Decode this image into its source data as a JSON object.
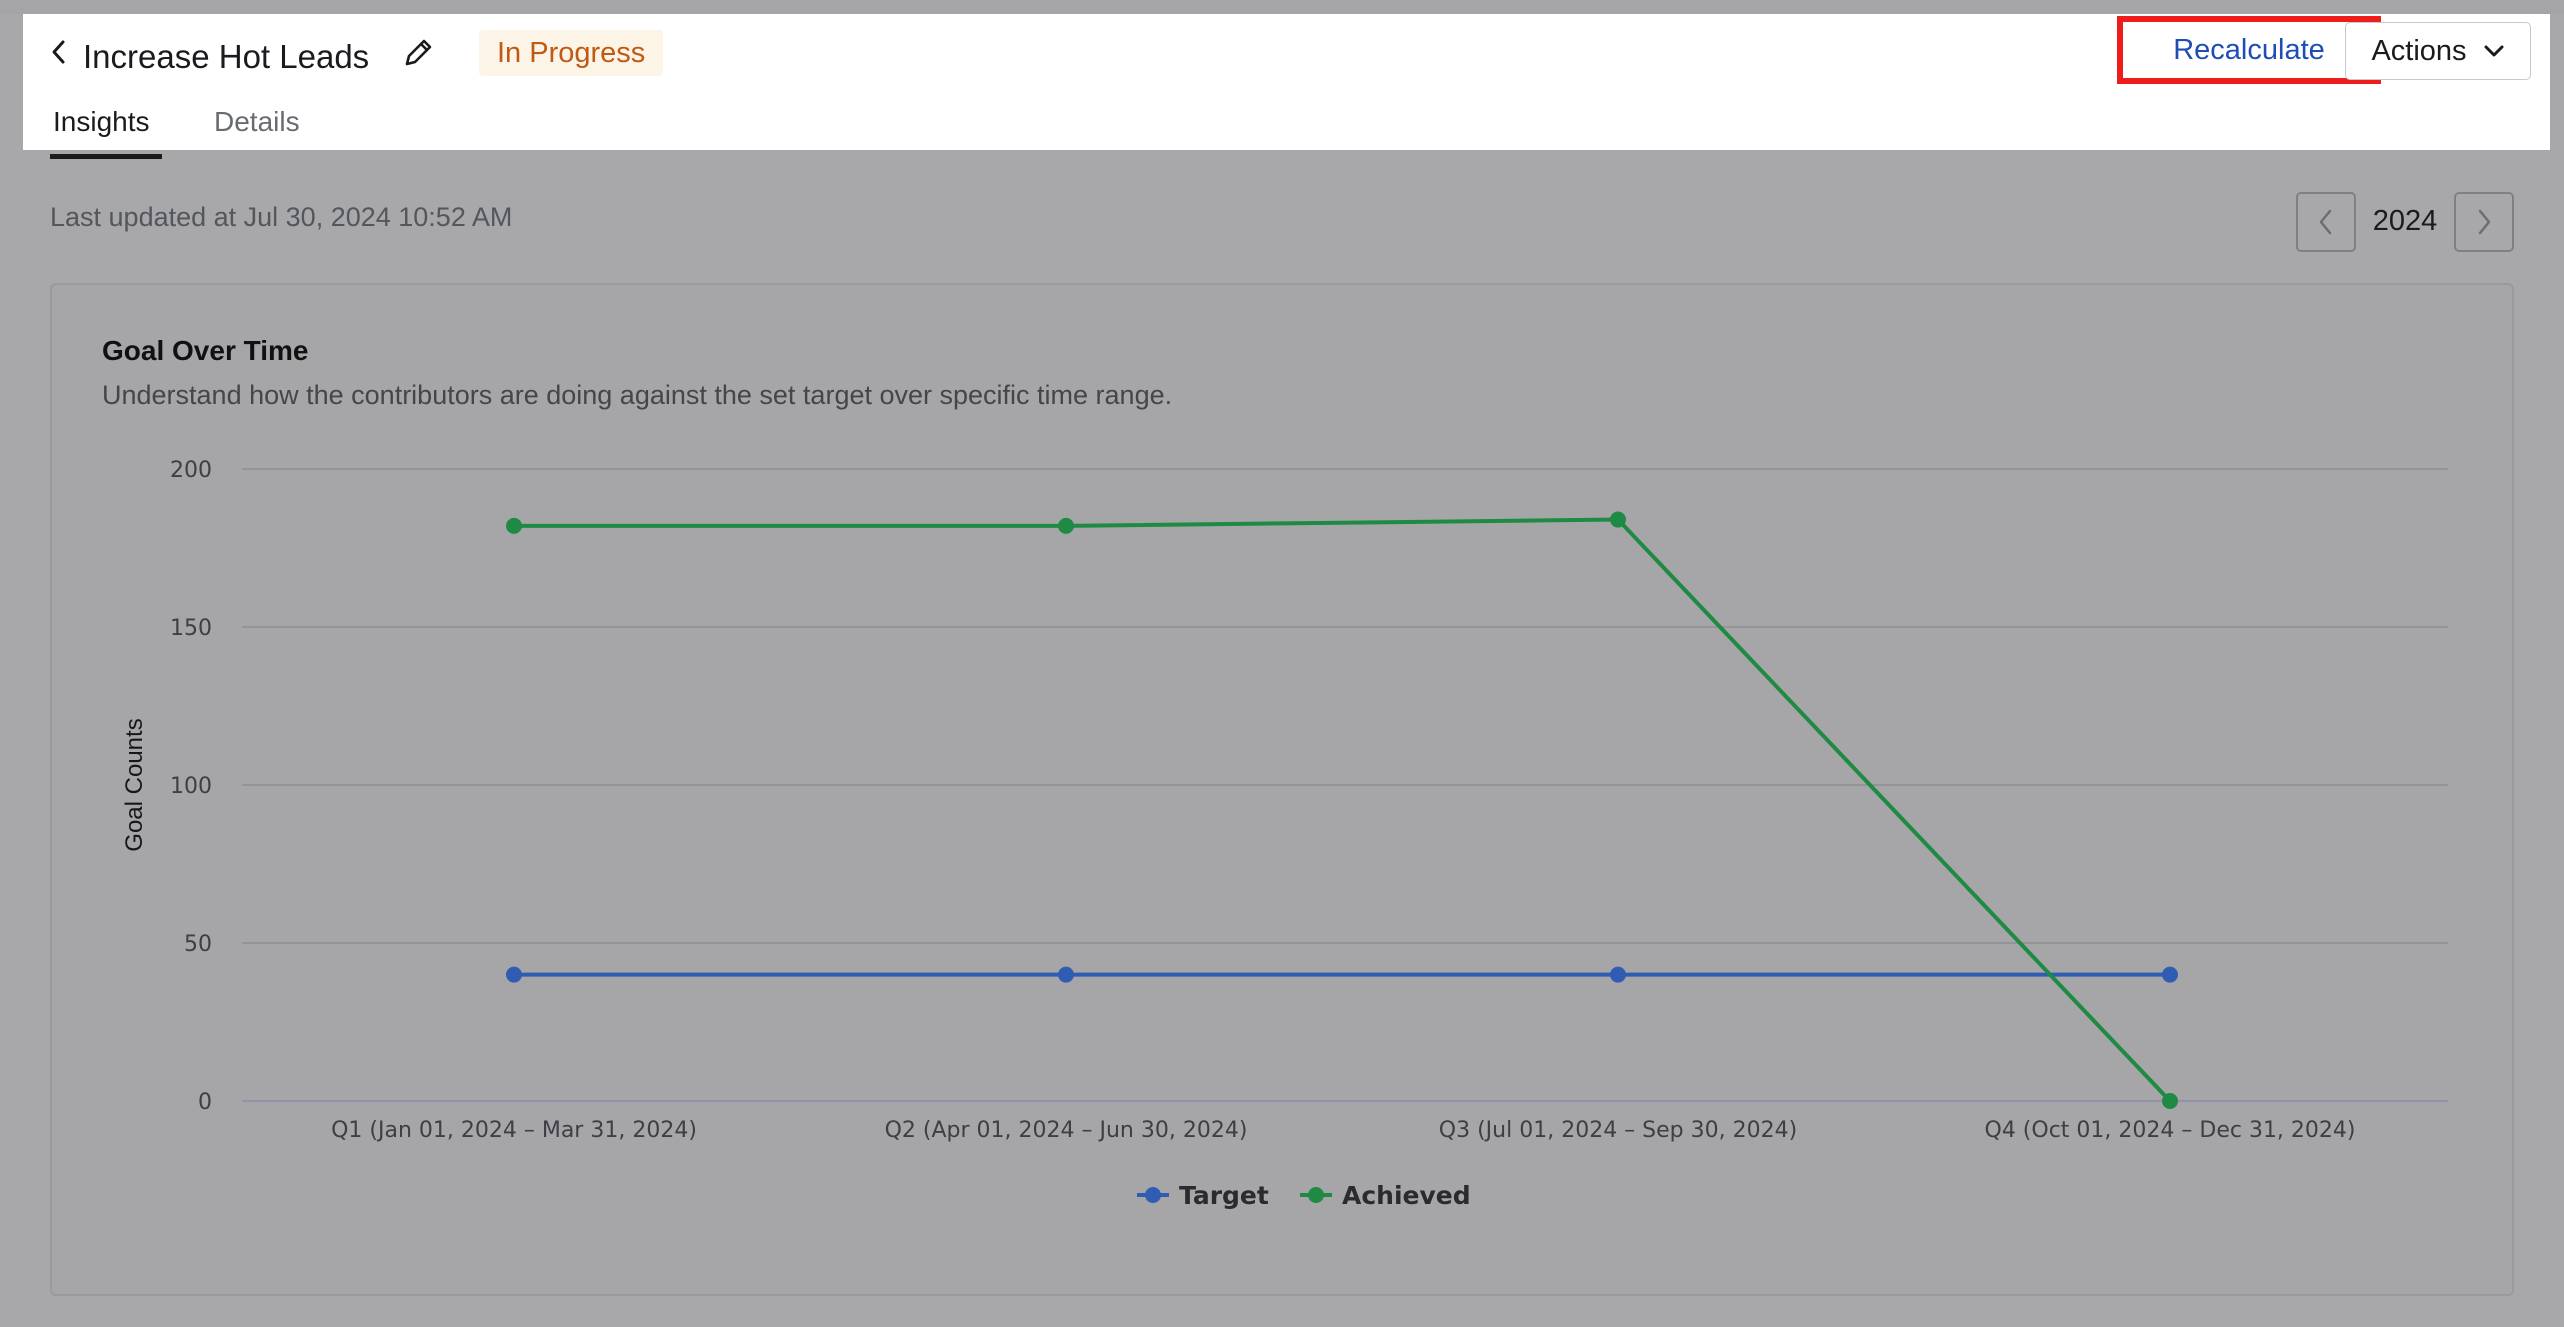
{
  "header": {
    "title": "Increase Hot Leads",
    "status": "In Progress",
    "recalculate_label": "Recalculate",
    "actions_label": "Actions",
    "tabs": [
      {
        "label": "Insights",
        "active": true
      },
      {
        "label": "Details",
        "active": false
      }
    ]
  },
  "meta": {
    "last_updated": "Last updated at Jul 30, 2024 10:52 AM",
    "year": "2024"
  },
  "card": {
    "title": "Goal Over Time",
    "subtitle": "Understand how the contributors are doing against the set target over specific time range."
  },
  "colors": {
    "target": "#2f5db3",
    "achieved": "#1f8a43",
    "status_text": "#c05a12",
    "recalculate_text": "#1f4db8",
    "highlight_border": "#ef1c1c"
  },
  "icons": {
    "back": "chevron-left-icon",
    "edit": "pencil-icon",
    "actions": "chevron-down-icon",
    "prev_year": "chevron-left-icon",
    "next_year": "chevron-right-icon"
  },
  "chart_data": {
    "type": "line",
    "title": "",
    "xlabel": "",
    "ylabel": "Goal Counts",
    "ylim": [
      0,
      200
    ],
    "yticks": [
      0,
      50,
      100,
      150,
      200
    ],
    "grid": true,
    "legend_position": "bottom-center",
    "categories": [
      "Q1 (Jan 01, 2024 – Mar 31, 2024)",
      "Q2 (Apr 01, 2024 – Jun 30, 2024)",
      "Q3 (Jul 01, 2024 – Sep 30, 2024)",
      "Q4 (Oct 01, 2024 – Dec 31, 2024)"
    ],
    "series": [
      {
        "name": "Target",
        "color": "#2f5db3",
        "values": [
          40,
          40,
          40,
          40
        ]
      },
      {
        "name": "Achieved",
        "color": "#1f8a43",
        "values": [
          182,
          182,
          184,
          0
        ]
      }
    ]
  }
}
